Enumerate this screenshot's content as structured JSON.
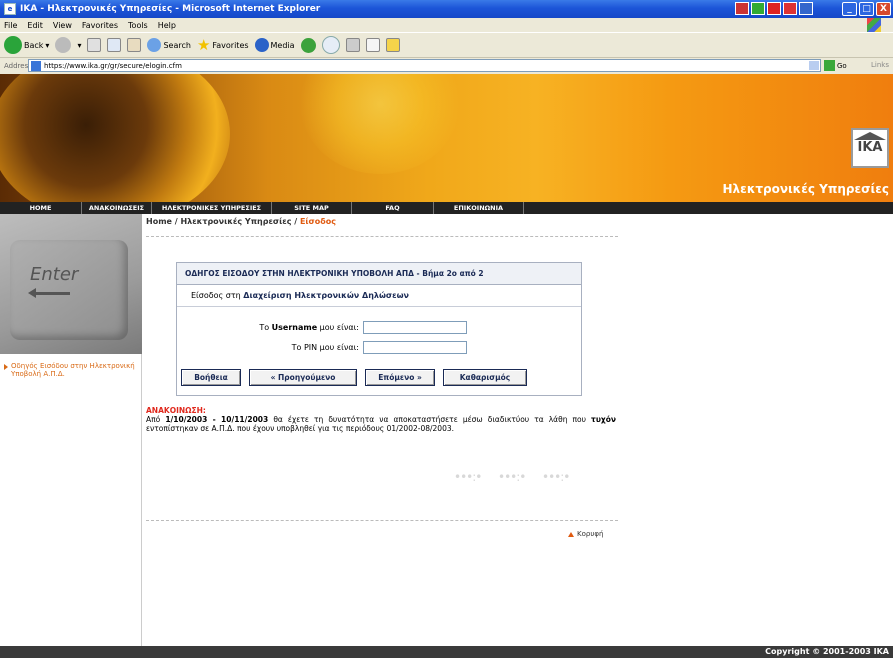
{
  "window": {
    "title": "IKA - Ηλεκτρονικές Υπηρεσίες - Microsoft Internet Explorer",
    "controls": [
      "_",
      "□",
      "X"
    ]
  },
  "menubar": {
    "items": [
      "File",
      "Edit",
      "View",
      "Favorites",
      "Tools",
      "Help"
    ]
  },
  "toolbar": {
    "back_label": "Back",
    "search_label": "Search",
    "favorites_label": "Favorites",
    "media_label": "Media"
  },
  "address": {
    "label": "Address",
    "url": "https://www.ika.gr/gr/secure/elogin.cfm",
    "go_label": "Go",
    "links_label": "Links"
  },
  "banner": {
    "logo_text": "IKA",
    "title": "Ηλεκτρονικές Υπηρεσίες"
  },
  "nav": {
    "items": [
      "HOME",
      "ΑΝΑΚΟΙΝΩΣΕΙΣ",
      "ΗΛΕΚΤΡΟΝΙΚΕΣ ΥΠΗΡΕΣΙΕΣ",
      "SITE MAP",
      "FAQ",
      "ΕΠΙΚΟΙΝΩΝΙΑ"
    ]
  },
  "sidebar": {
    "key_label": "Enter",
    "link": "Οδηγός Εισόδου στην Ηλεκτρονική Υποβολή Α.Π.Δ."
  },
  "breadcrumb": {
    "home": "Home",
    "sep1": " / ",
    "section": "Ηλεκτρονικές Υπηρεσίες",
    "sep2": " / ",
    "current": "Είσοδος"
  },
  "wizard": {
    "heading": "ΟΔΗΓΟΣ ΕΙΣΟΔΟΥ ΣΤΗΝ ΗΛΕΚΤΡΟΝΙΚΗ ΥΠΟΒΟΛΗ ΑΠΔ - Βήμα 2ο από 2",
    "sub_prefix": "Είσοδος στη ",
    "sub_bold": "Διαχείριση Ηλεκτρονικών Δηλώσεων",
    "username_prefix": "Το ",
    "username_bold": "Username",
    "username_suffix": " μου είναι:",
    "username_value": "",
    "pin_label": "Το PIN μου είναι:",
    "pin_value": "",
    "buttons": {
      "help": "Βοήθεια",
      "previous": "« Προηγούμενο",
      "next": "Επόμενο »",
      "clear": "Καθαρισμός"
    }
  },
  "notice": {
    "title": "ΑΝΑΚΟΙΝΩΣΗ:",
    "from_word": "Από ",
    "date_range": "1/10/2003 - 10/11/2003",
    "text_a": " θα έχετε τη δυνατότητα να αποκαταστήσετε μέσω διαδικτύου τα λάθη που ",
    "bold_word": "τυχόν",
    "text_b": " εντοπίστηκαν σε Α.Π.Δ. που έχουν υποβληθεί για τις περιόδους 01/2002-08/2003."
  },
  "footer": {
    "top_link": "Κορυφή",
    "copyright": "Copyright © 2001-2003 IKA"
  }
}
